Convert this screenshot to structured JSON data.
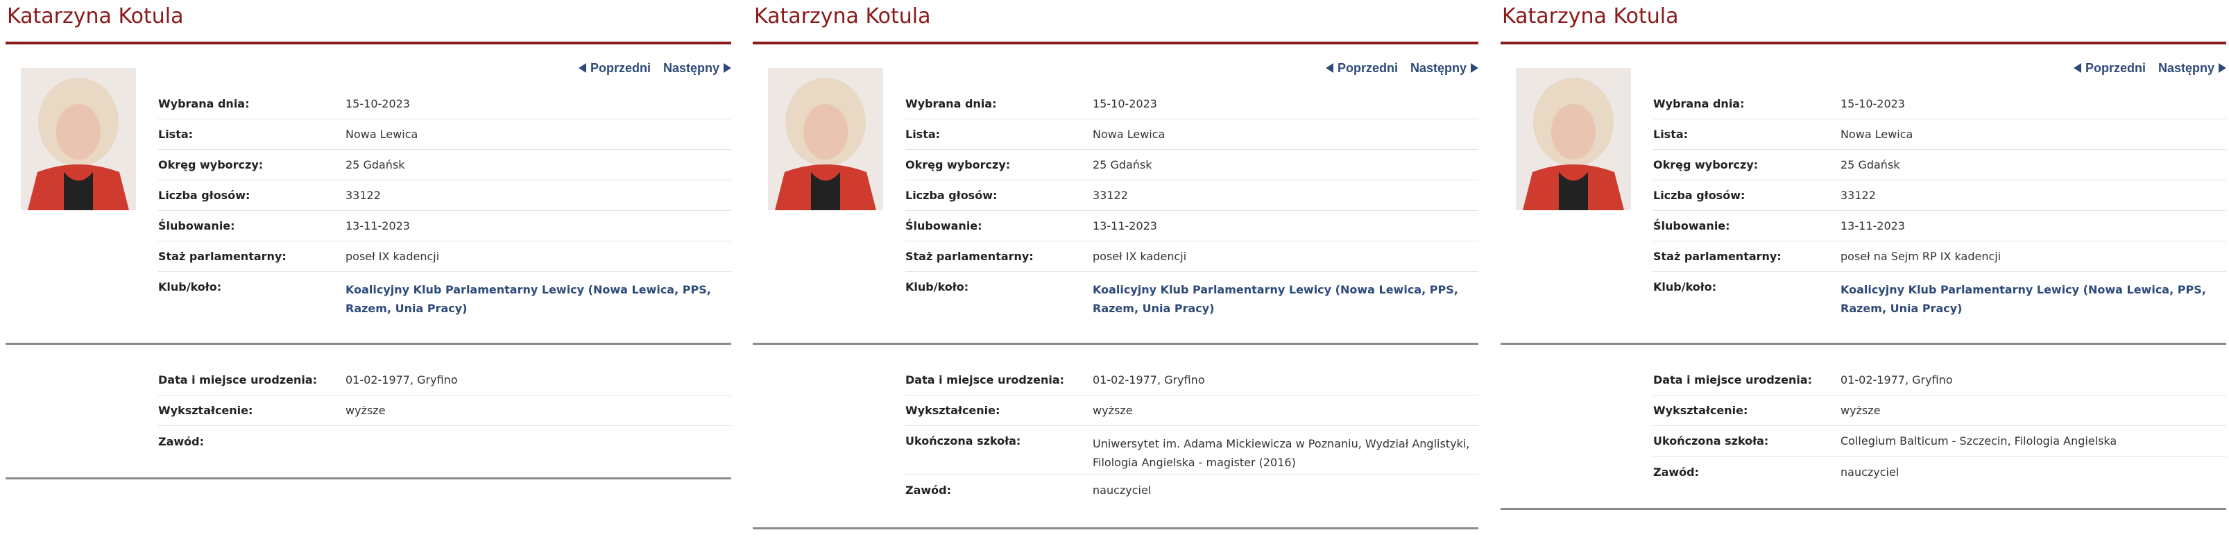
{
  "nav": {
    "prev": "Poprzedni",
    "next": "Następny"
  },
  "panels": [
    {
      "name": "Katarzyna Kotula",
      "labels": {
        "elected": "Wybrana dnia:",
        "list": "Lista:",
        "district": "Okręg wyborczy:",
        "votes": "Liczba głosów:",
        "oath": "Ślubowanie:",
        "tenure": "Staż parlamentarny:",
        "club": "Klub/koło:",
        "birth": "Data i miejsce urodzenia:",
        "education": "Wykształcenie:",
        "school": "",
        "profession": "Zawód:"
      },
      "values": {
        "elected": "15-10-2023",
        "list": "Nowa Lewica",
        "district": "25  Gdańsk",
        "votes": "33122",
        "oath": "13-11-2023",
        "tenure": "poseł IX kadencji",
        "club": "Koalicyjny Klub Parlamentarny Lewicy (Nowa Lewica, PPS, Razem, Unia Pracy)",
        "birth": "01-02-1977, Gryfino",
        "education": "wyższe",
        "school": "",
        "profession": ""
      }
    },
    {
      "name": "Katarzyna Kotula",
      "labels": {
        "elected": "Wybrana dnia:",
        "list": "Lista:",
        "district": "Okręg wyborczy:",
        "votes": "Liczba głosów:",
        "oath": "Ślubowanie:",
        "tenure": "Staż parlamentarny:",
        "club": "Klub/koło:",
        "birth": "Data i miejsce urodzenia:",
        "education": "Wykształcenie:",
        "school": "Ukończona szkoła:",
        "profession": "Zawód:"
      },
      "values": {
        "elected": "15-10-2023",
        "list": "Nowa Lewica",
        "district": "25  Gdańsk",
        "votes": "33122",
        "oath": "13-11-2023",
        "tenure": "poseł IX kadencji",
        "club": "Koalicyjny Klub Parlamentarny Lewicy (Nowa Lewica, PPS, Razem, Unia Pracy)",
        "birth": "01-02-1977, Gryfino",
        "education": "wyższe",
        "school": "Uniwersytet im. Adama Mickiewicza w Poznaniu, Wydział Anglistyki, Filologia Angielska - magister (2016)",
        "profession": "nauczyciel"
      }
    },
    {
      "name": "Katarzyna Kotula",
      "labels": {
        "elected": "Wybrana dnia:",
        "list": "Lista:",
        "district": "Okręg wyborczy:",
        "votes": "Liczba głosów:",
        "oath": "Ślubowanie:",
        "tenure": "Staż parlamentarny:",
        "club": "Klub/koło:",
        "birth": "Data i miejsce urodzenia:",
        "education": "Wykształcenie:",
        "school": "Ukończona szkoła:",
        "profession": "Zawód:"
      },
      "values": {
        "elected": "15-10-2023",
        "list": "Nowa Lewica",
        "district": "25  Gdańsk",
        "votes": "33122",
        "oath": "13-11-2023",
        "tenure": "poseł na Sejm RP IX kadencji",
        "club": "Koalicyjny Klub Parlamentarny Lewicy (Nowa Lewica, PPS, Razem, Unia Pracy)",
        "birth": "01-02-1977, Gryfino",
        "education": "wyższe",
        "school": "Collegium Balticum - Szczecin, Filologia Angielska",
        "profession": "nauczyciel"
      }
    }
  ]
}
